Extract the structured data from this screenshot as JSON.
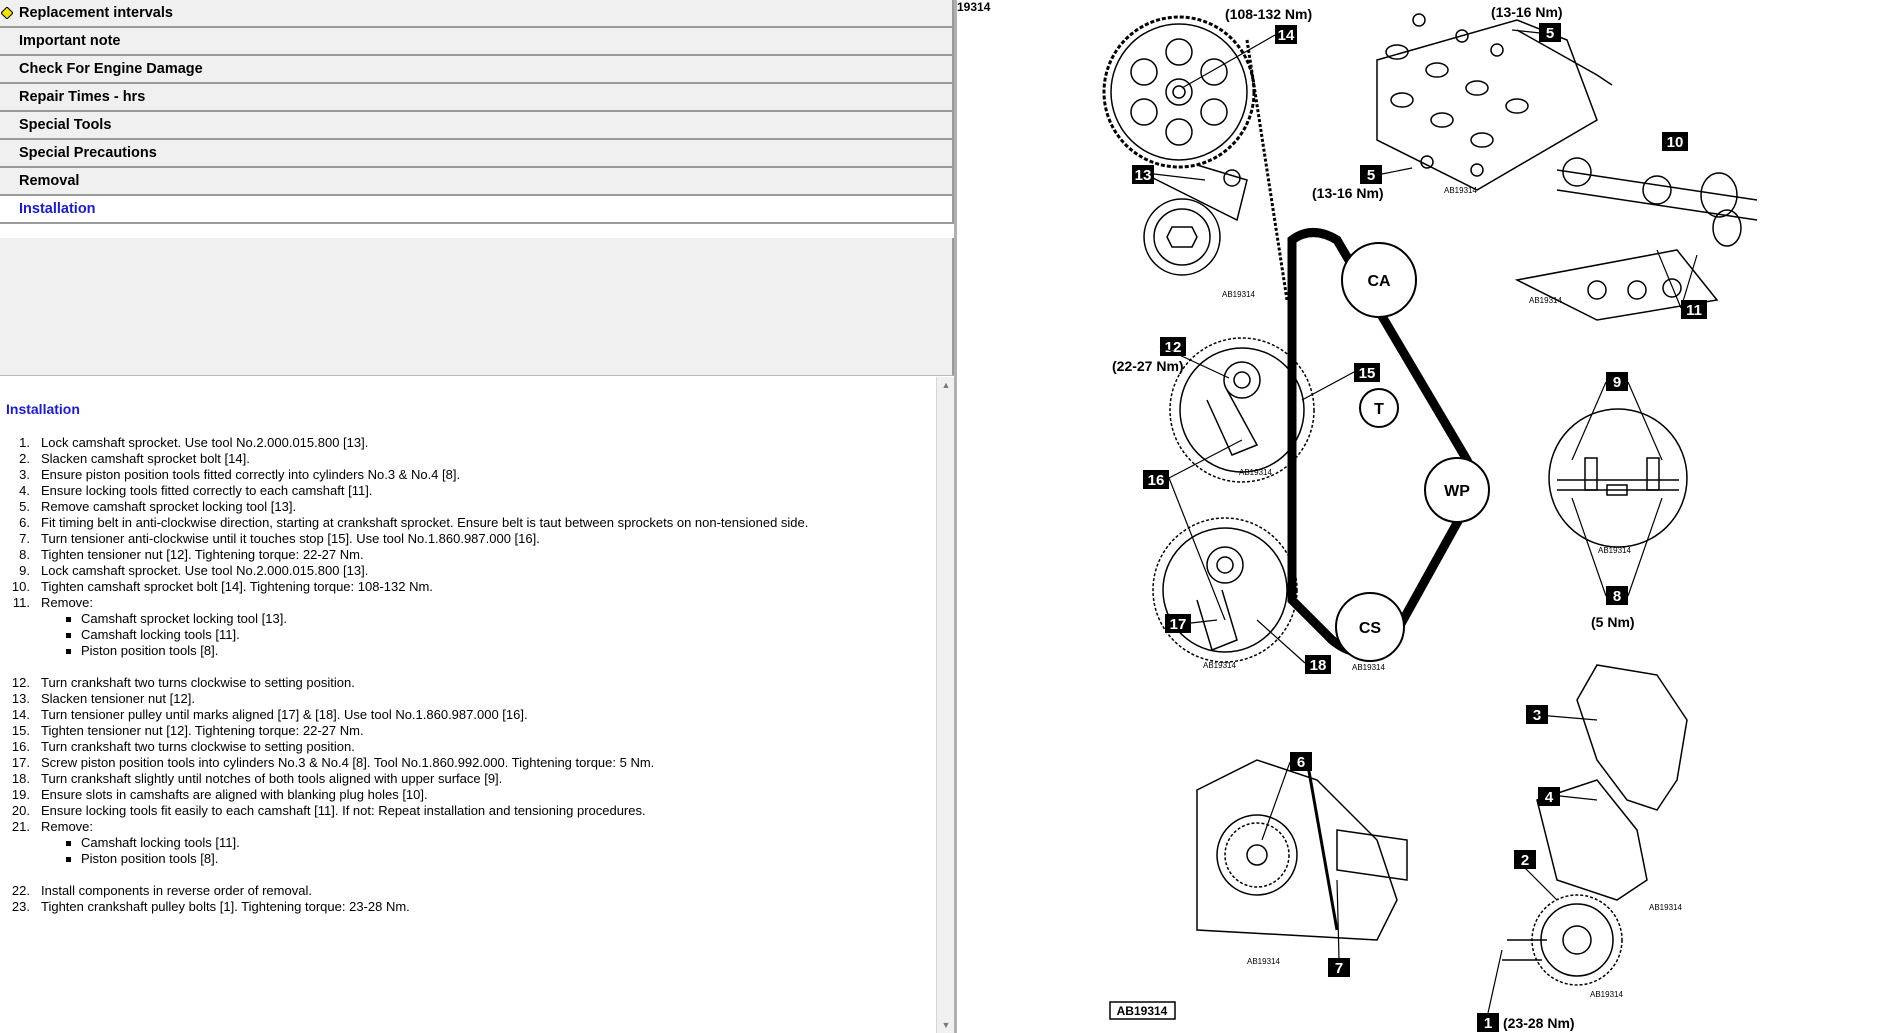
{
  "nav": {
    "items": [
      {
        "label": "Replacement intervals"
      },
      {
        "label": "Important note"
      },
      {
        "label": "Check For Engine Damage"
      },
      {
        "label": "Repair Times - hrs"
      },
      {
        "label": "Special Tools"
      },
      {
        "label": "Special Precautions"
      },
      {
        "label": "Removal"
      },
      {
        "label": "Installation"
      }
    ],
    "active_index": 7
  },
  "content": {
    "title": "Installation",
    "steps": [
      {
        "num": "1.",
        "text": "Lock camshaft sprocket. Use tool No.2.000.015.800 [13]."
      },
      {
        "num": "2.",
        "text": "Slacken camshaft sprocket bolt [14]."
      },
      {
        "num": "3.",
        "text": "Ensure piston position tools fitted correctly into cylinders No.3 & No.4 [8]."
      },
      {
        "num": "4.",
        "text": "Ensure locking tools fitted correctly to each camshaft [11]."
      },
      {
        "num": "5.",
        "text": "Remove camshaft sprocket locking tool [13]."
      },
      {
        "num": "6.",
        "text": "Fit timing belt in anti-clockwise direction, starting at crankshaft sprocket. Ensure belt is taut between sprockets on non-tensioned side."
      },
      {
        "num": "7.",
        "text": "Turn tensioner anti-clockwise until it touches stop [15]. Use tool No.1.860.987.000 [16]."
      },
      {
        "num": "8.",
        "text": "Tighten tensioner nut [12]. Tightening torque: 22-27 Nm."
      },
      {
        "num": "9.",
        "text": "Lock camshaft sprocket. Use tool No.2.000.015.800 [13]."
      },
      {
        "num": "10.",
        "text": "Tighten camshaft sprocket bolt [14]. Tightening torque: 108-132 Nm."
      },
      {
        "num": "11.",
        "text": "Remove:",
        "sub": [
          "Camshaft sprocket locking tool [13].",
          "Camshaft locking tools [11].",
          "Piston position tools [8]."
        ]
      },
      {
        "num": "12.",
        "text": "Turn crankshaft two turns clockwise to setting position."
      },
      {
        "num": "13.",
        "text": "Slacken tensioner nut [12]."
      },
      {
        "num": "14.",
        "text": "Turn tensioner pulley until marks aligned [17] & [18]. Use tool No.1.860.987.000 [16]."
      },
      {
        "num": "15.",
        "text": "Tighten tensioner nut [12]. Tightening torque: 22-27 Nm."
      },
      {
        "num": "16.",
        "text": "Turn crankshaft two turns clockwise to setting position."
      },
      {
        "num": "17.",
        "text": "Screw piston position tools into cylinders No.3 & No.4 [8]. Tool No.1.860.992.000. Tightening torque: 5 Nm."
      },
      {
        "num": "18.",
        "text": "Turn crankshaft slightly until notches of both tools aligned with upper surface [9]."
      },
      {
        "num": "19.",
        "text": "Ensure slots in camshafts are aligned with blanking plug holes [10]."
      },
      {
        "num": "20.",
        "text": "Ensure locking tools fit easily to each camshaft [11]. If not: Repeat installation and tensioning procedures."
      },
      {
        "num": "21.",
        "text": "Remove:",
        "sub": [
          "Camshaft locking tools [11].",
          "Piston position tools [8]."
        ]
      },
      {
        "num": "22.",
        "text": "Install components in reverse order of removal."
      },
      {
        "num": "23.",
        "text": "Tighten crankshaft pulley bolts [1]. Tightening torque: 23-28 Nm."
      }
    ]
  },
  "diagram": {
    "ref_number": "19314",
    "figure_id": "AB19314",
    "sub_id": "AB19314",
    "callouts": {
      "c1": "1",
      "c2": "2",
      "c3": "3",
      "c4": "4",
      "c5a": "5",
      "c5b": "5",
      "c6": "6",
      "c7": "7",
      "c8": "8",
      "c9": "9",
      "c10": "10",
      "c11": "11",
      "c12": "12",
      "c13": "13",
      "c14": "14",
      "c15": "15",
      "c16": "16",
      "c17": "17",
      "c18": "18"
    },
    "torques": {
      "t14": "(108-132 Nm)",
      "t5a": "(13-16 Nm)",
      "t5b": "(13-16 Nm)",
      "t12": "(22-27 Nm)",
      "t8": "(5 Nm)",
      "t1": "(23-28 Nm)"
    },
    "belt_labels": {
      "ca": "CA",
      "t": "T",
      "wp": "WP",
      "cs": "CS"
    }
  }
}
